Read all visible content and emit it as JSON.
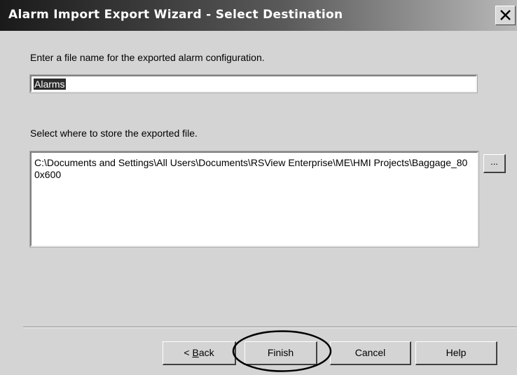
{
  "window": {
    "title": "Alarm Import Export Wizard - Select Destination",
    "close_icon": "close-icon"
  },
  "filename_section": {
    "prompt": "Enter a file name for the exported alarm configuration.",
    "value": "Alarms"
  },
  "destination_section": {
    "prompt": "Select where to store the exported file.",
    "path": "C:\\Documents and Settings\\All Users\\Documents\\RSView Enterprise\\ME\\HMI Projects\\Baggage_800x600",
    "browse_label": "..."
  },
  "buttons": {
    "back_prefix": "< ",
    "back_mnemonic": "B",
    "back_rest": "ack",
    "finish": "Finish",
    "cancel": "Cancel",
    "help": "Help"
  },
  "annotation": {
    "highlight": "ellipse circling Finish button",
    "color": "#000000"
  }
}
